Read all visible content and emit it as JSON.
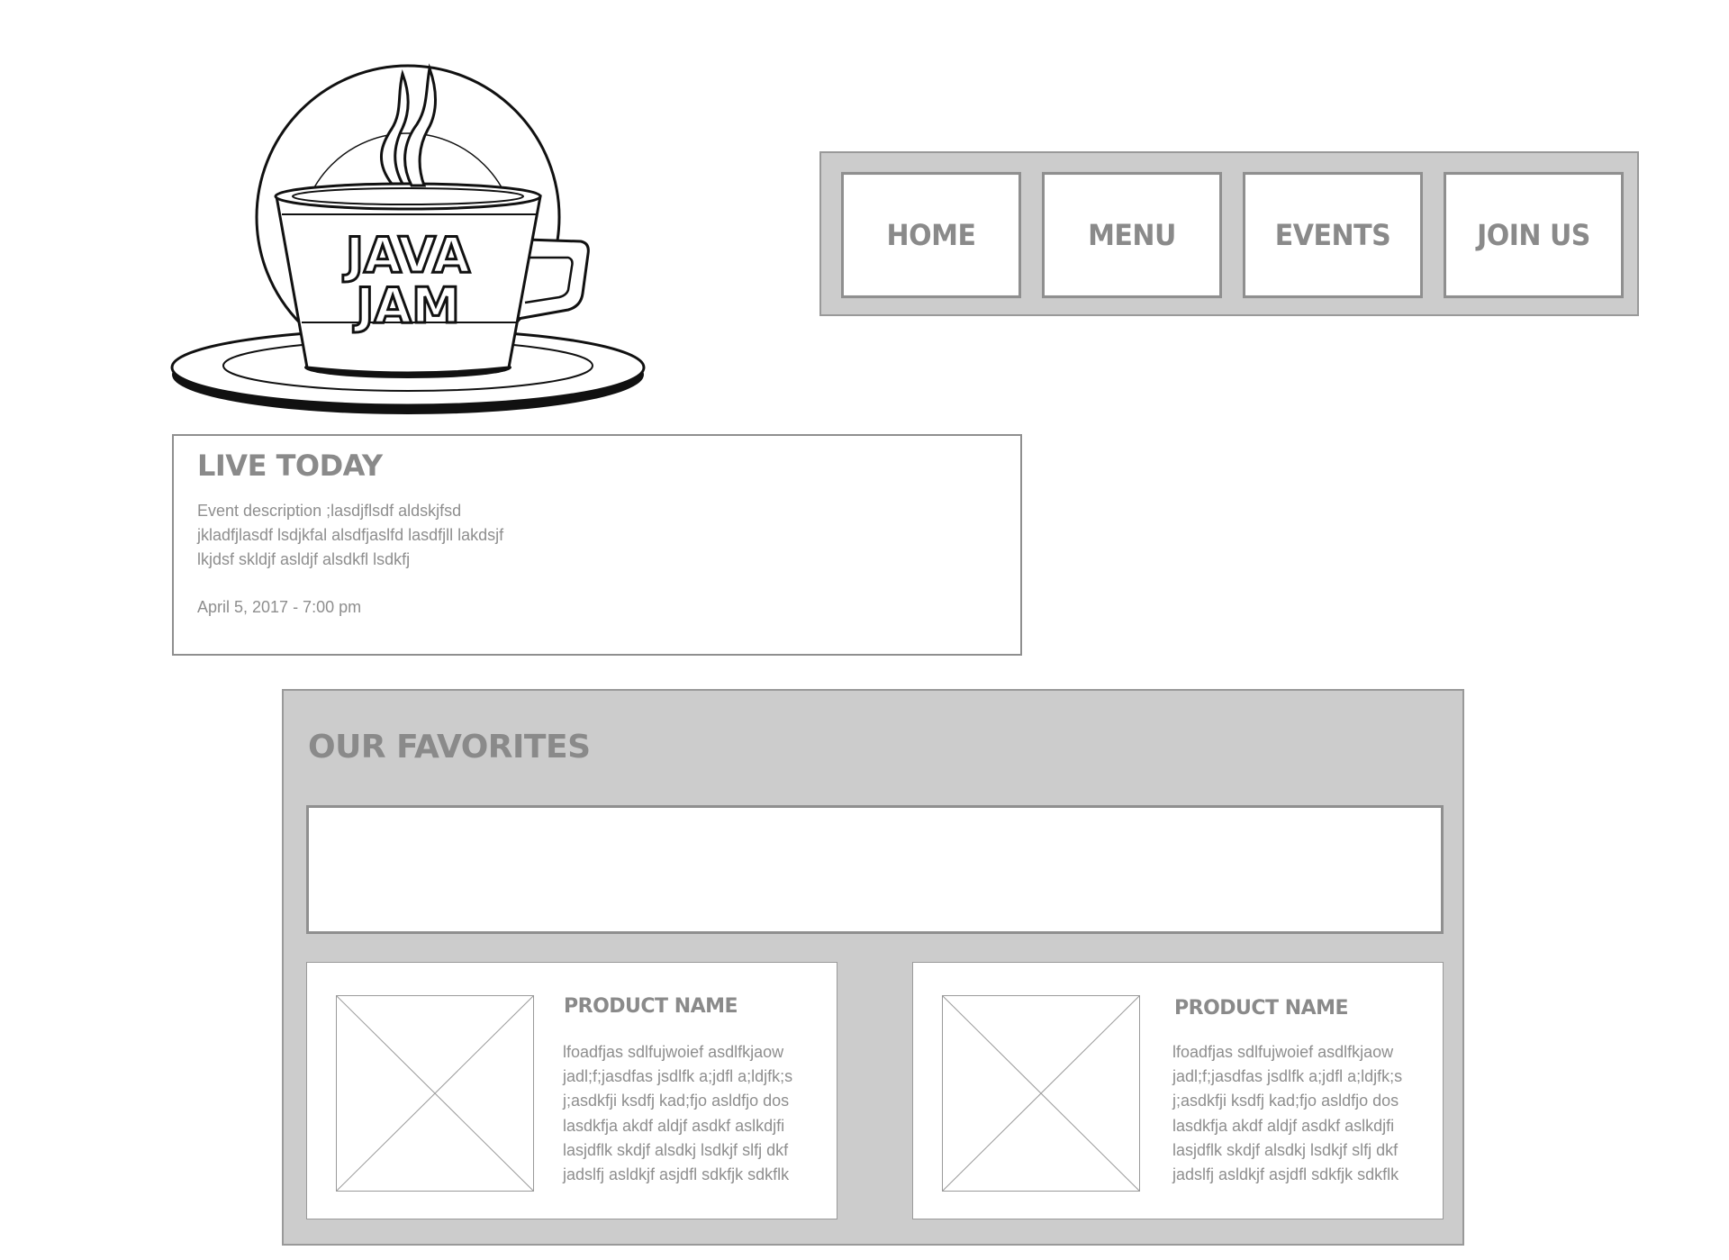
{
  "logo": {
    "alt": "Java Jam",
    "line1": "JAVA",
    "line2": "JAM"
  },
  "nav": {
    "items": [
      {
        "label": "Home"
      },
      {
        "label": "Menu"
      },
      {
        "label": "Events"
      },
      {
        "label": "Join Us"
      }
    ]
  },
  "live": {
    "title": "Live Today",
    "description": "Event description ;lasdjflsdf aldskjfsd jkladfjlasdf lsdjkfal alsdfjaslfd lasdfjll lakdsjf lkjdsf skldjf asldjf alsdkfl lsdkfj",
    "date": "April 5, 2017 - 7:00 pm"
  },
  "favorites": {
    "title": "Our Favorites",
    "products": [
      {
        "name": "Product Name",
        "description": "lfoadfjas sdlfujwoief asdlfkjaow\njadl;f;jasdfas jsdlfk a;jdfl a;ldjfk;s\nj;asdkfji ksdfj kad;fjo asldfjo dos\nlasdkfja akdf aldjf asdkf  aslkdjfi\nlasjdflk skdjf alsdkj lsdkjf slfj dkf\njadslfj asldkjf asjdfl sdkfjk sdkflk"
      },
      {
        "name": "Product Name",
        "description": "lfoadfjas sdlfujwoief asdlfkjaow\njadl;f;jasdfas jsdlfk a;jdfl a;ldjfk;s\nj;asdkfji ksdfj kad;fjo asldfjo dos\nlasdkfja akdf aldjf asdkf  aslkdjfi\nlasjdflk skdjf alsdkj lsdkjf slfj dkf\njadslfj asldkjf asjdfl sdkfjk sdkflk"
      }
    ]
  },
  "colors": {
    "panel": "#cccccc",
    "border": "#8f8f8f",
    "text": "#8a8a8a"
  }
}
